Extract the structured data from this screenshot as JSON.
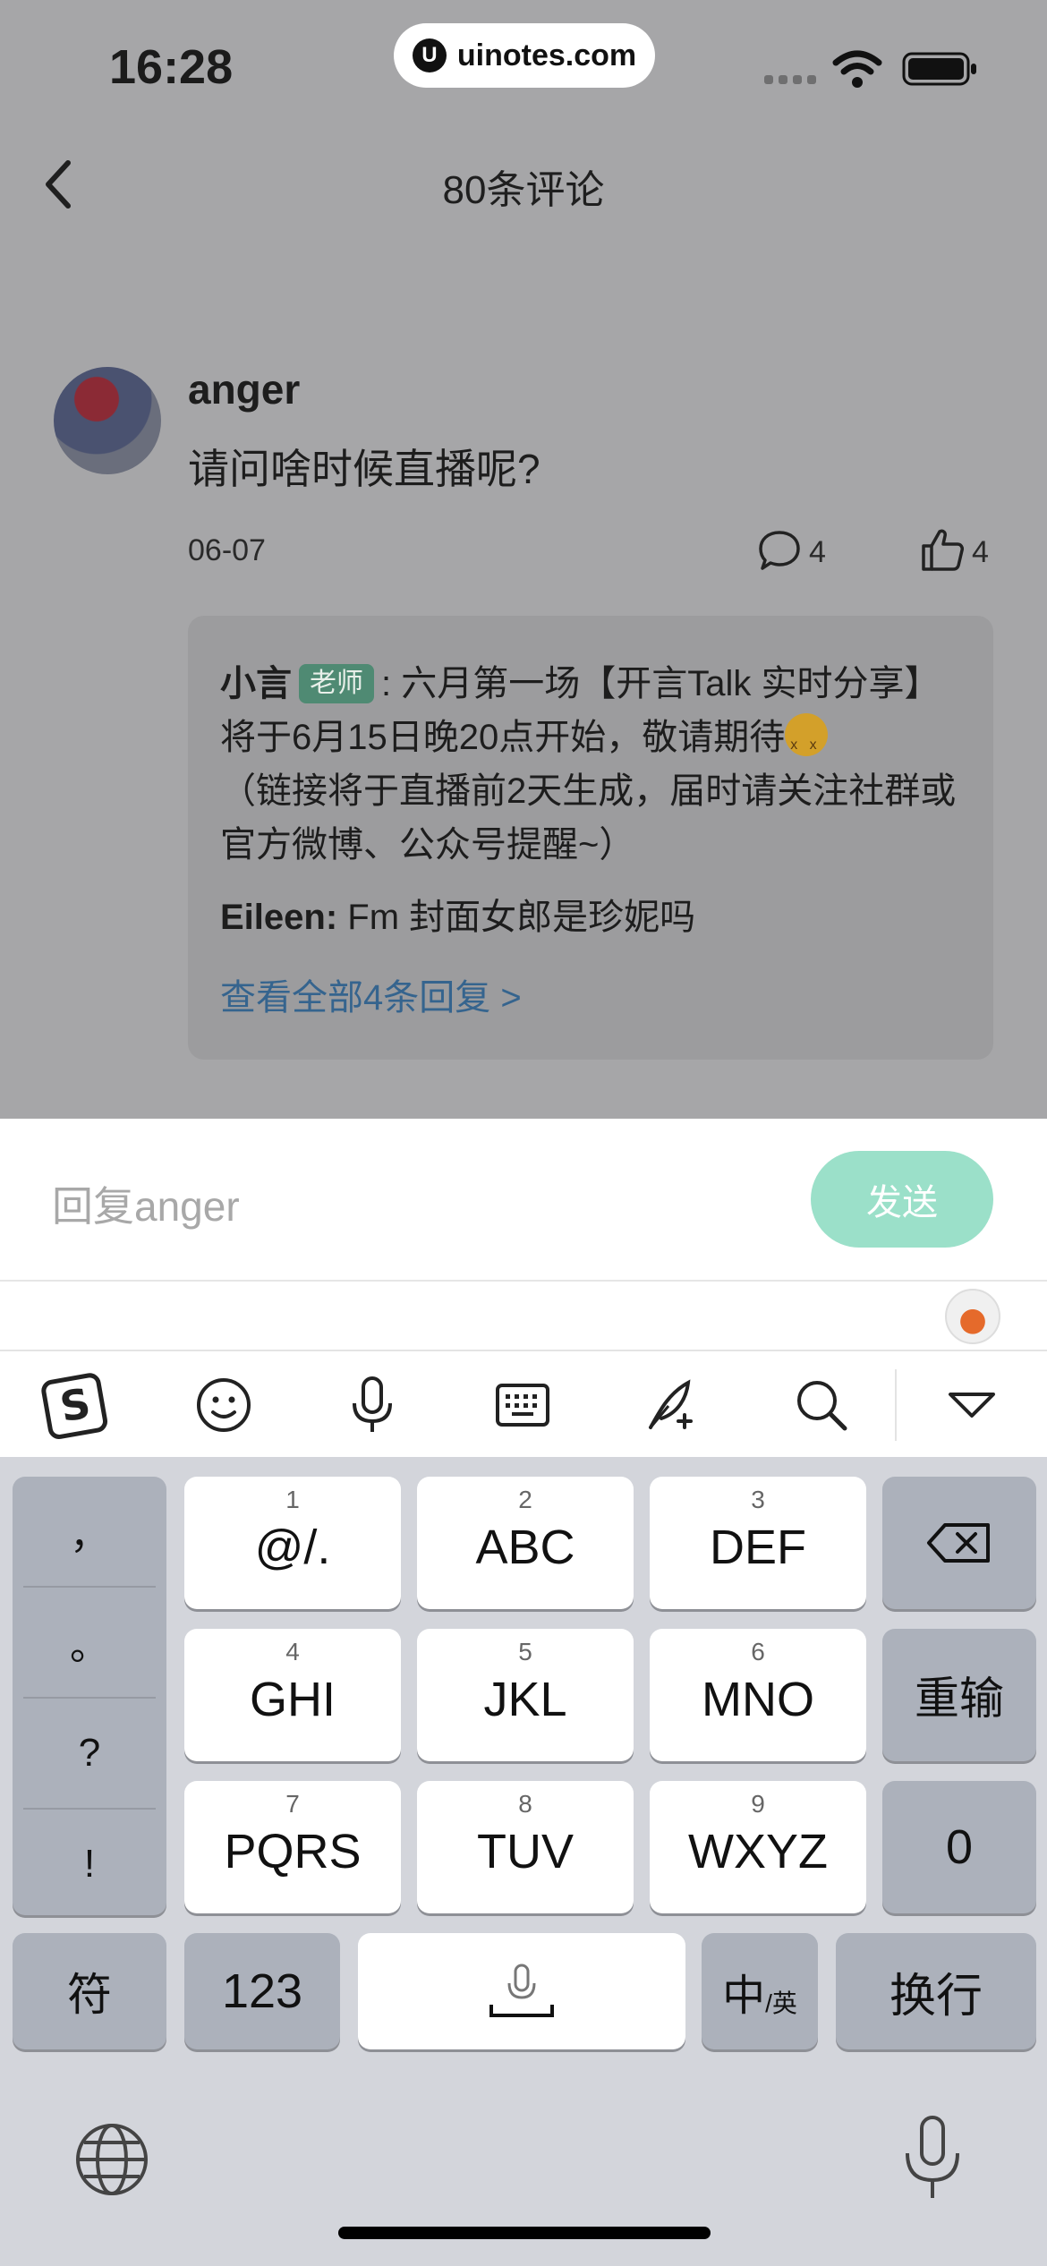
{
  "status_bar": {
    "time": "16:28",
    "url": "uinotes.com",
    "url_logo": "U",
    "icons": [
      "signal-icon",
      "wifi-icon",
      "battery-icon"
    ]
  },
  "nav": {
    "title": "80条评论",
    "back_icon": "back-chevron-icon"
  },
  "comment": {
    "username": "anger",
    "text": "请问啥时候直播呢?",
    "date": "06-07",
    "comment_count": "4",
    "like_count": "4",
    "replies": [
      {
        "author": "小言",
        "badge": "老师",
        "text": ": 六月第一场【开言Talk 实时分享】将于6月15日晚20点开始，敬请期待",
        "text_after_emoji": "（链接将于直播前2天生成，届时请关注社群或官方微博、公众号提醒~）"
      },
      {
        "author": "Eileen:",
        "text": " Fm 封面女郎是珍妮吗"
      }
    ],
    "view_all": "查看全部4条回复 >"
  },
  "composer": {
    "placeholder": "回复anger",
    "send_label": "发送"
  },
  "keyboard_toolbar": {
    "icons": [
      "sogou-logo-icon",
      "emoji-icon",
      "microphone-icon",
      "keyboard-icon",
      "quill-pen-icon",
      "search-icon",
      "collapse-chevron-icon"
    ]
  },
  "keyboard": {
    "punctuation": [
      "，",
      "。",
      "?",
      "!"
    ],
    "keys": [
      {
        "num": "1",
        "label": "@/."
      },
      {
        "num": "2",
        "label": "ABC"
      },
      {
        "num": "3",
        "label": "DEF"
      },
      {
        "num": "4",
        "label": "GHI"
      },
      {
        "num": "5",
        "label": "JKL"
      },
      {
        "num": "6",
        "label": "MNO"
      },
      {
        "num": "7",
        "label": "PQRS"
      },
      {
        "num": "8",
        "label": "TUV"
      },
      {
        "num": "9",
        "label": "WXYZ"
      }
    ],
    "retype": "重输",
    "zero": "0",
    "symbols": "符",
    "numbers": "123",
    "lang_main": "中",
    "lang_sub": "/英",
    "enter": "换行"
  }
}
